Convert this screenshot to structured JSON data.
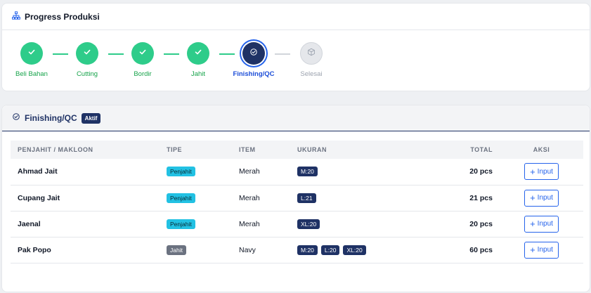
{
  "progress": {
    "title": "Progress Produksi",
    "steps": [
      {
        "label": "Beli Bahan",
        "status": "done"
      },
      {
        "label": "Cutting",
        "status": "done"
      },
      {
        "label": "Bordir",
        "status": "done"
      },
      {
        "label": "Jahit",
        "status": "done"
      },
      {
        "label": "Finishing/QC",
        "status": "active"
      },
      {
        "label": "Selesai",
        "status": "pending"
      }
    ]
  },
  "stage": {
    "title": "Finishing/QC",
    "badge": "Aktif",
    "table": {
      "headers": {
        "penjahit": "PENJAHIT / MAKLOON",
        "tipe": "TIPE",
        "item": "ITEM",
        "ukuran": "UKURAN",
        "total": "TOTAL",
        "aksi": "AKSI"
      },
      "rows": [
        {
          "name": "Ahmad Jait",
          "tipe": "Penjahit",
          "item": "Merah",
          "sizes": [
            "M:20"
          ],
          "total": "20 pcs",
          "action": "Input"
        },
        {
          "name": "Cupang Jait",
          "tipe": "Penjahit",
          "item": "Merah",
          "sizes": [
            "L:21"
          ],
          "total": "21 pcs",
          "action": "Input"
        },
        {
          "name": "Jaenal",
          "tipe": "Penjahit",
          "item": "Merah",
          "sizes": [
            "XL:20"
          ],
          "total": "20 pcs",
          "action": "Input"
        },
        {
          "name": "Pak Popo",
          "tipe": "Jahit",
          "item": "Navy",
          "sizes": [
            "M:20",
            "L:20",
            "XL:20"
          ],
          "total": "60 pcs",
          "action": "Input"
        }
      ]
    }
  },
  "colors": {
    "success": "#2ecc8a",
    "primary": "#1f3265",
    "accent": "#2563eb",
    "info": "#22c1e3",
    "muted": "#6b7280"
  }
}
